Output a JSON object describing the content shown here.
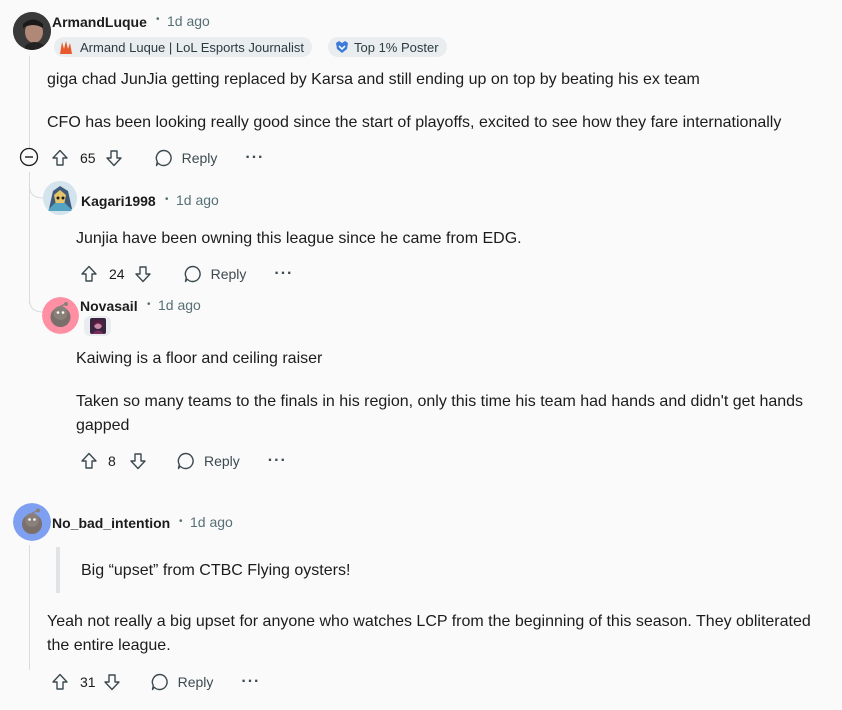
{
  "comments": [
    {
      "username": "ArmandLuque",
      "time": "1d ago",
      "flair": "Armand Luque | LoL Esports Journalist",
      "badge": "Top 1% Poster",
      "paragraphs": [
        "giga chad JunJia getting replaced by Karsa and still ending up on top by beating his ex team",
        "CFO has been looking really good since the start of playoffs, excited to see how they fare internationally"
      ],
      "votes": "65",
      "reply_label": "Reply",
      "more_label": "···"
    },
    {
      "username": "Kagari1998",
      "time": "1d ago",
      "paragraphs": [
        "Junjia have been owning this league since he came from EDG."
      ],
      "votes": "24",
      "reply_label": "Reply",
      "more_label": "···"
    },
    {
      "username": "Novasail",
      "time": "1d ago",
      "paragraphs": [
        "Kaiwing is a floor and ceiling raiser",
        "Taken so many teams to the finals in his region, only this time his team had hands and didn't get hands gapped"
      ],
      "votes": "8",
      "reply_label": "Reply",
      "more_label": "···"
    },
    {
      "username": "No_bad_intention",
      "time": "1d ago",
      "quote": "Big “upset” from CTBC Flying oysters!",
      "paragraphs": [
        "Yeah not really a big upset for anyone who watches LCP from the beginning of this season. They obliterated the entire league."
      ],
      "votes": "31",
      "reply_label": "Reply",
      "more_label": "···"
    }
  ],
  "separator": "•",
  "colors": {
    "background": "#fafafa",
    "thread_line": "#d7dcde",
    "meta_text": "#576f76",
    "flair_bg": "#eaedef"
  }
}
